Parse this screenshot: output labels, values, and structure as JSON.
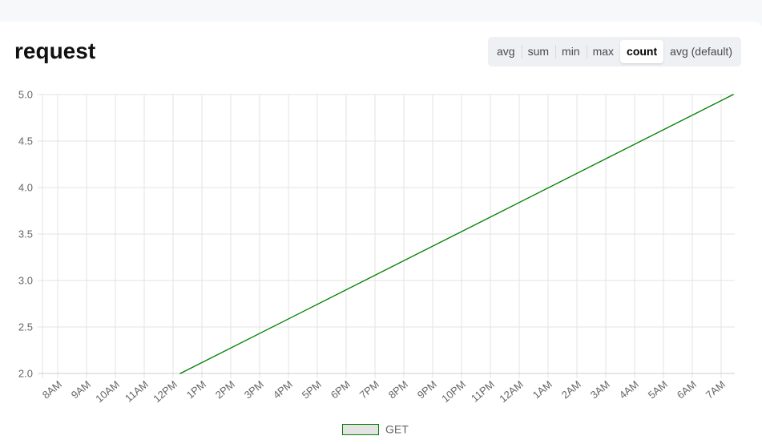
{
  "panel": {
    "title": "request"
  },
  "aggregations": {
    "options": [
      "avg",
      "sum",
      "min",
      "max",
      "count",
      "avg (default)"
    ],
    "selected": "count"
  },
  "chart_data": {
    "type": "line",
    "title": "request",
    "xlabel": "",
    "ylabel": "",
    "categories": [
      "8AM",
      "9AM",
      "10AM",
      "11AM",
      "12PM",
      "1PM",
      "2PM",
      "3PM",
      "4PM",
      "5PM",
      "6PM",
      "7PM",
      "8PM",
      "9PM",
      "10PM",
      "11PM",
      "12AM",
      "1AM",
      "2AM",
      "3AM",
      "4AM",
      "5AM",
      "6AM",
      "7AM"
    ],
    "ylim": [
      2.0,
      5.0
    ],
    "yticks": [
      "5.0",
      "4.5",
      "4.0",
      "3.5",
      "3.0",
      "2.5",
      "2.0"
    ],
    "grid": true,
    "legend_position": "bottom",
    "series": [
      {
        "name": "GET",
        "color": "#008000",
        "points": [
          {
            "x": "12:15PM",
            "y": 2.0
          },
          {
            "x": "7:25AM",
            "y": 5.0
          }
        ]
      }
    ]
  }
}
